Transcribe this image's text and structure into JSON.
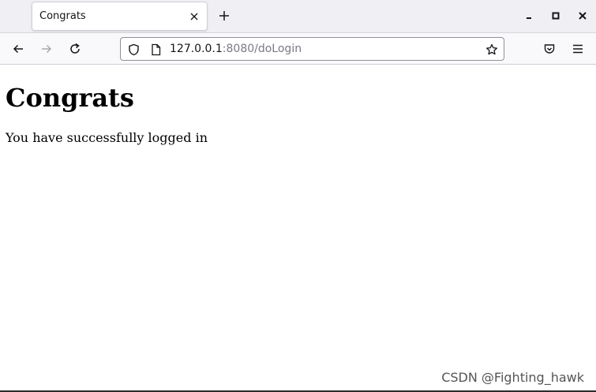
{
  "browser": {
    "tab": {
      "title": "Congrats"
    },
    "url": {
      "host": "127.0.0.1",
      "rest": ":8080/doLogin"
    }
  },
  "page": {
    "heading": "Congrats",
    "message": "You have successfully logged in"
  },
  "watermark": "CSDN @Fighting_hawk",
  "icons": {
    "tab_close": "close-icon",
    "new_tab": "plus-icon",
    "minimize": "minimize-icon",
    "maximize": "maximize-icon",
    "close_window": "close-icon",
    "back": "arrow-left-icon",
    "forward": "arrow-right-icon",
    "reload": "reload-icon",
    "shield": "shield-icon",
    "page": "page-icon",
    "bookmark": "star-icon",
    "pocket": "pocket-icon",
    "menu": "hamburger-icon"
  },
  "colors": {
    "tabstrip_bg": "#f0f0f4",
    "navbar_bg": "#f9f9fb",
    "url_path": "#7a7a85",
    "text": "#15141a"
  }
}
